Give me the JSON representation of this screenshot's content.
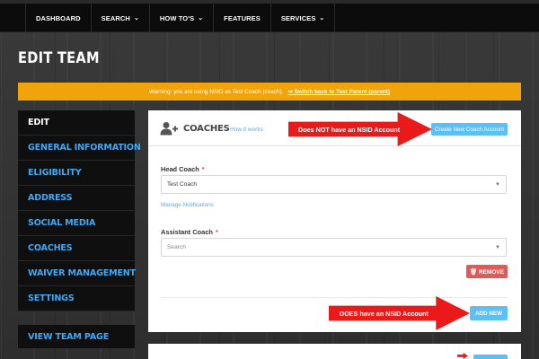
{
  "nav": {
    "items": [
      {
        "label": "DASHBOARD",
        "caret": false
      },
      {
        "label": "SEARCH",
        "caret": true
      },
      {
        "label": "HOW TO'S",
        "caret": true
      },
      {
        "label": "FEATURES",
        "caret": false
      },
      {
        "label": "SERVICES",
        "caret": true
      }
    ],
    "caret_glyph": "⌄"
  },
  "page": {
    "title": "EDIT TEAM"
  },
  "warning": {
    "text": "Warning: you are using NSID as Test Coach (coach).",
    "link": "⇒ Switch back to Test Parent (parent)",
    "color": "#f0a40a"
  },
  "sidebar": {
    "items": [
      {
        "label": "EDIT",
        "active": true
      },
      {
        "label": "GENERAL INFORMATION"
      },
      {
        "label": "ELIGIBILITY"
      },
      {
        "label": "ADDRESS"
      },
      {
        "label": "SOCIAL MEDIA"
      },
      {
        "label": "COACHES"
      },
      {
        "label": "WAIVER MANAGEMENT"
      },
      {
        "label": "SETTINGS"
      }
    ],
    "view_team": "VIEW TEAM PAGE"
  },
  "coaches": {
    "icon": "add-user-icon",
    "title": "COACHES",
    "how_link": "How it works",
    "create_button": "Create New Coach Account",
    "head_coach": {
      "label": "Head Coach",
      "required": "*",
      "value": "Test Coach"
    },
    "manage_link": "Manage Notifications",
    "assistant_coach": {
      "label": "Assistant Coach",
      "required": "*",
      "placeholder": "Search"
    },
    "remove_button": "🗑 REMOVE",
    "add_new_button": "ADD NEW"
  },
  "annotations": {
    "arrow1": "Does NOT have an NSID Account",
    "arrow2": "DOES have an NSID Account"
  },
  "colors": {
    "accent_blue": "#3fa9f5",
    "button_blue": "#5bc0f5",
    "remove_red": "#e05a56",
    "arrow_red": "#ea1a1a"
  }
}
